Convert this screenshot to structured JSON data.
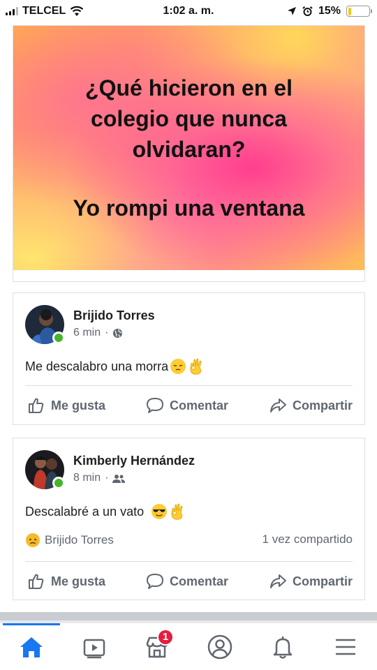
{
  "status_bar": {
    "carrier": "TELCEL",
    "time": "1:02 a. m.",
    "battery": "15%",
    "battery_level": 0.15
  },
  "banner_post": {
    "line1": "¿Qué hicieron en el",
    "line2": "colegio que nunca",
    "line3": "olvidaran?",
    "line4": "Yo rompi una ventana"
  },
  "comments": [
    {
      "author": "Brijido Torres",
      "time": "6 min",
      "audience_icon": "globe-icon",
      "text": "Me descalabro una morra",
      "emojis": [
        "pensive-face",
        "ok-hand"
      ]
    },
    {
      "author": "Kimberly Hernández",
      "time": "8 min",
      "audience_icon": "friends-icon",
      "text": "Descalabré a un vato",
      "emojis": [
        "sunglasses-face",
        "ok-hand"
      ],
      "reaction_by": "Brijido Torres",
      "shares": "1 vez compartido"
    }
  ],
  "actions": {
    "like": "Me gusta",
    "comment": "Comentar",
    "share": "Compartir"
  },
  "bottom_nav": {
    "items": [
      "home-icon",
      "watch-icon",
      "marketplace-icon",
      "profile-icon",
      "notifications-icon",
      "menu-icon"
    ],
    "marketplace_badge": "1",
    "active_color": "#1877f2"
  }
}
